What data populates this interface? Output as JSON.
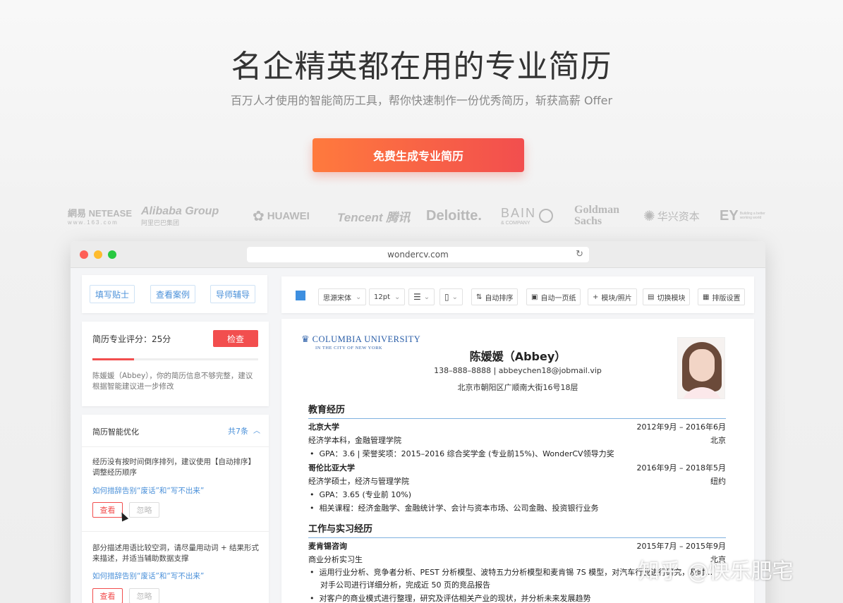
{
  "hero": {
    "title": "名企精英都在用的专业简历",
    "subtitle": "百万人才使用的智能简历工具，帮你快速制作一份优秀简历，斩获高薪 Offer",
    "cta_label": "免费生成专业简历"
  },
  "logos": [
    {
      "name": "網易 NETEASE",
      "sub": "www.163.com"
    },
    {
      "name": "Alibaba Group",
      "sub": "阿里巴巴集团"
    },
    {
      "name": "HUAWEI"
    },
    {
      "name": "Tencent 腾讯"
    },
    {
      "name": "Deloitte."
    },
    {
      "name": "BAIN",
      "sub": "& COMPANY"
    },
    {
      "name": "Goldman",
      "sub": "Sachs"
    },
    {
      "name": "华兴资本"
    },
    {
      "name": "EY",
      "sub": "Building a better working world"
    }
  ],
  "browser": {
    "url": "wondercv.com"
  },
  "left_panel": {
    "tabs": [
      "填写贴士",
      "查看案例",
      "导师辅导"
    ],
    "score_label": "简历专业评分：25分",
    "score_value": 25,
    "check_button": "检查",
    "score_desc": "陈媛媛（Abbey），你的简历信息不够完整，建议根据智能建议进一步修改",
    "optimize_title": "简历智能优化",
    "optimize_count": "共7条",
    "suggestions": [
      {
        "text": "经历没有按时间倒序排列，建议使用【自动排序】调整经历顺序",
        "link": "如何措辞告别“废话”和“写不出来”",
        "view": "查看",
        "ignore": "忽略"
      },
      {
        "text": "部分描述用语比较空洞，请尽量用动词 + 结果形式来描述，并适当辅助数据支撑",
        "link": "如何措辞告别“废话”和“写不出来”",
        "view": "查看",
        "ignore": "忽略"
      }
    ]
  },
  "toolbar": {
    "font": "思源宋体",
    "size": "12pt",
    "auto_sort": "自动排序",
    "one_page": "自动一页纸",
    "module_photo": "模块/照片",
    "switch_module": "切换模块",
    "layout": "排版设置"
  },
  "resume": {
    "university_logo": "COLUMBIA UNIVERSITY",
    "university_sub": "IN THE CITY OF NEW YORK",
    "name": "陈媛媛（Abbey）",
    "contact": "138–888–8888 | abbeychen18@jobmail.vip",
    "address": "北京市朝阳区广顺南大街16号18层",
    "edu_title": "教育经历",
    "edu": [
      {
        "school": "北京大学",
        "date": "2012年9月 – 2016年6月",
        "degree": "经济学本科，金融管理学院",
        "city": "北京",
        "bullets": [
          "GPA：3.6 | 荣誉奖项：2015–2016 综合奖学金 (专业前15%)、WonderCV领导力奖"
        ]
      },
      {
        "school": "哥伦比亚大学",
        "date": "2016年9月 – 2018年5月",
        "degree": "经济学硕士，经济与管理学院",
        "city": "纽约",
        "bullets": [
          "GPA：3.65 (专业前 10%)",
          "相关课程：经济金融学、金融统计学、会计与资本市场、公司金融、投资银行业务"
        ]
      }
    ],
    "work_title": "工作与实习经历",
    "work": [
      {
        "company": "麦肯锡咨询",
        "date": "2015年7月 – 2015年9月",
        "role": "商业分析实习生",
        "city": "北京",
        "bullets": [
          "运用行业分析、竞争者分析、PEST 分析模型、波特五力分析模型和麦肯锡 7S 模型，对汽车行业进行研究，及时…",
          "对手公司进行详细分析，完成近 50 页的竞品报告",
          "对客户的商业模式进行整理，研究及评估相关产业的现状，并分析未来发展趋势"
        ]
      }
    ]
  },
  "watermark": "知乎 @快乐肥宅",
  "colors": {
    "accent": "#f24e4e",
    "cta_start": "#ff7a3d",
    "link": "#4a90d9",
    "rule": "#7fb1e0"
  }
}
